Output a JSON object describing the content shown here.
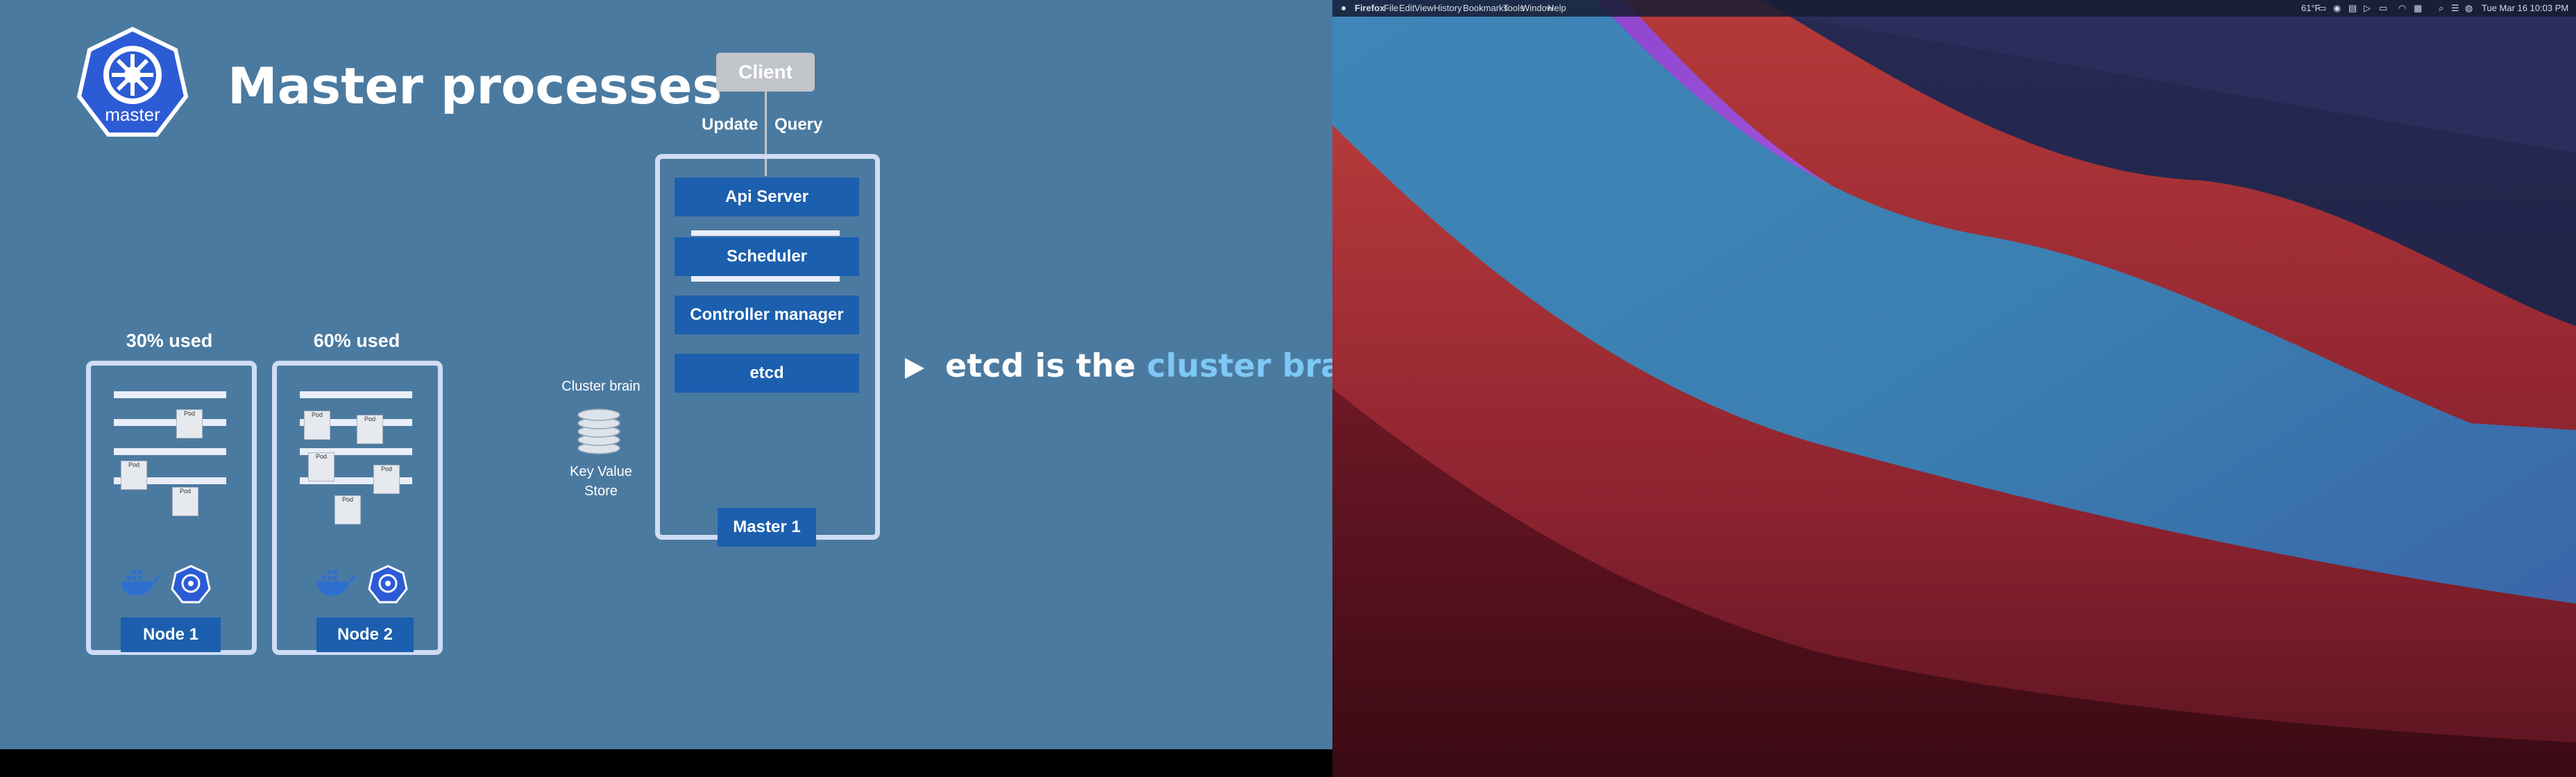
{
  "slide": {
    "title": "Master processes",
    "logo_label": "master",
    "client_label": "Client",
    "update_label": "Update",
    "query_label": "Query",
    "components": [
      "Api Server",
      "Scheduler",
      "Controller manager",
      "etcd"
    ],
    "master_label": "Master 1",
    "cluster_brain_label": "Cluster brain",
    "kv_store_label": "Key Value\nStore",
    "node1": {
      "usage": "30% used",
      "label": "Node 1"
    },
    "node2": {
      "usage": "60% used",
      "label": "Node 2"
    },
    "pod_label": "Pod",
    "callout": {
      "prefix": "etcd is the ",
      "highlight": "cluster brain",
      "suffix": "!"
    },
    "colors": {
      "background": "#4b7aa0",
      "component_blue": "#1b5fae",
      "frame": "#d0dcf5",
      "highlight": "#7ec8f5"
    }
  },
  "menubar": {
    "apple_icon": "apple-icon",
    "app_name": "Firefox",
    "menus": [
      "File",
      "Edit",
      "View",
      "History",
      "Bookmarks",
      "Tools",
      "Window",
      "Help"
    ],
    "status": {
      "temperature": "61°F",
      "datetime": "Tue Mar 16  10:03 PM"
    },
    "status_icons": [
      "display-icon",
      "record-icon",
      "clipboard-icon",
      "play-icon",
      "battery-icon",
      "wifi-icon",
      "input-method-icon",
      "search-icon",
      "control-center-icon",
      "siri-icon"
    ]
  }
}
